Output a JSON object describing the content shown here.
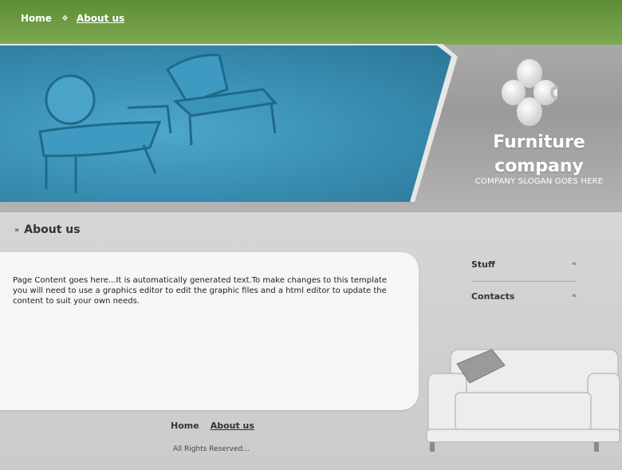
{
  "top_nav": {
    "home": "Home",
    "about": "About us"
  },
  "brand": {
    "title": "Furniture company",
    "slogan": "COMPANY SLOGAN GOES HERE"
  },
  "page": {
    "heading": "About us",
    "content": "Page Content goes here...It is automatically generated text.To make changes to this template you will need to use a graphics editor to edit the graphic files and a html editor to update the content to suit your own needs."
  },
  "sidebar": {
    "items": [
      {
        "label": "Stuff",
        "icon": "chevron-left-icon"
      },
      {
        "label": "Contacts",
        "icon": "chevron-left-icon"
      }
    ]
  },
  "footer": {
    "home": "Home",
    "about": "About us",
    "copyright": "All Rights Reserved..."
  },
  "colors": {
    "accent": "#6f9c45",
    "hero": "#3a90b5"
  }
}
